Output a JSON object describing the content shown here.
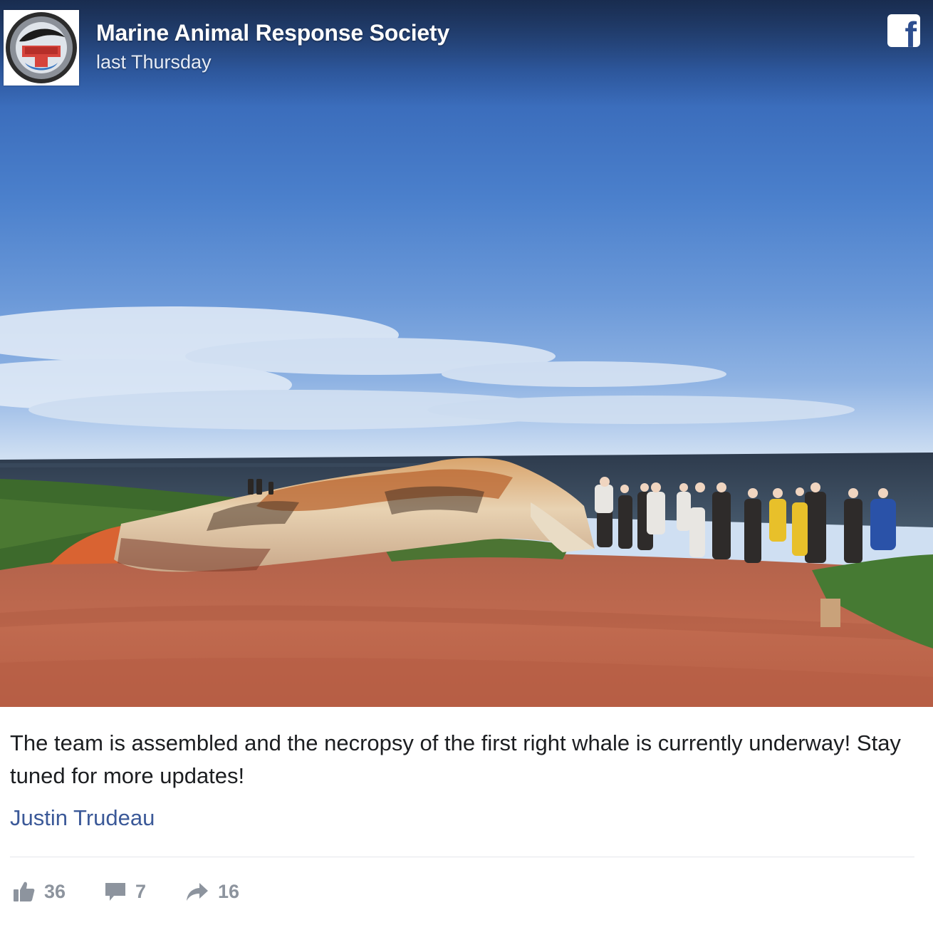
{
  "post": {
    "page_name": "Marine Animal Response Society",
    "timestamp": "last Thursday",
    "avatar_icon": "mars-logo-icon",
    "platform_icon": "facebook-icon",
    "caption": "The team is assembled and the necropsy of the first right whale is currently underway! Stay tuned for more updates!",
    "tagged_person": "Justin Trudeau",
    "photo": "stranded-right-whale-necropsy-photo"
  },
  "actions": {
    "likes": "36",
    "comments": "7",
    "shares": "16",
    "like_icon": "thumbs-up-icon",
    "comment_icon": "comment-icon",
    "share_icon": "share-arrow-icon"
  },
  "colors": {
    "link": "#3b5998",
    "text": "#1c1e21",
    "muted": "#8d949e",
    "facebook_blue": "#2d4e8f"
  }
}
